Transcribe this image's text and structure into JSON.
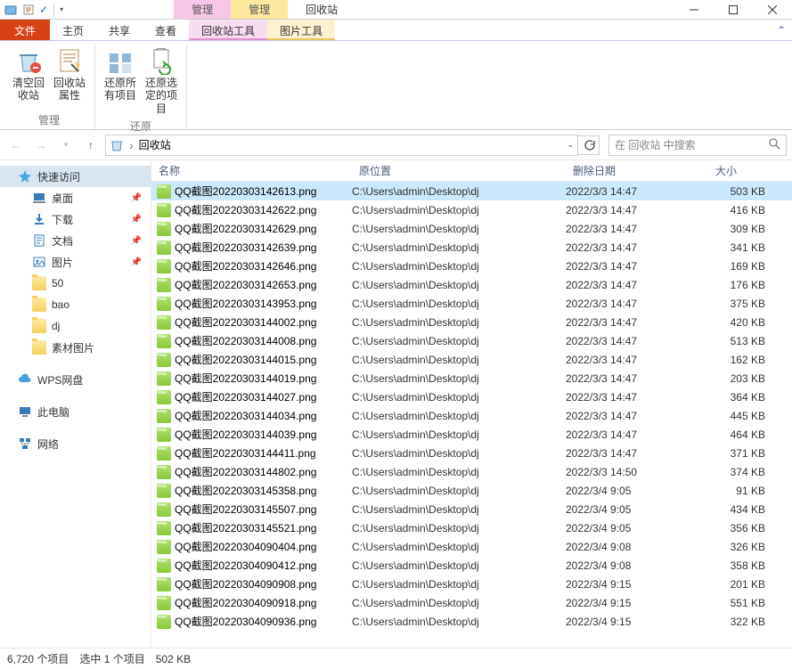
{
  "window": {
    "title": "回收站",
    "context_tab_pink": "管理",
    "context_tab_yellow": "管理"
  },
  "menu": {
    "file": "文件",
    "home": "主页",
    "share": "共享",
    "view": "查看",
    "recycle_tools": "回收站工具",
    "picture_tools": "图片工具"
  },
  "ribbon": {
    "group_manage": "管理",
    "group_restore": "还原",
    "empty_bin": "清空回收站",
    "bin_props": "回收站属性",
    "restore_all": "还原所有项目",
    "restore_selected": "还原选定的项目"
  },
  "toolbar": {
    "breadcrumb": "回收站",
    "search_placeholder": "在 回收站 中搜索"
  },
  "sidebar": {
    "quick_access": "快速访问",
    "items": [
      {
        "label": "桌面",
        "icon": "desktop",
        "pinned": true
      },
      {
        "label": "下载",
        "icon": "downloads",
        "pinned": true
      },
      {
        "label": "文档",
        "icon": "documents",
        "pinned": true
      },
      {
        "label": "图片",
        "icon": "pictures",
        "pinned": true
      },
      {
        "label": "50",
        "icon": "folder",
        "pinned": false
      },
      {
        "label": "bao",
        "icon": "folder",
        "pinned": false
      },
      {
        "label": "dj",
        "icon": "folder",
        "pinned": false
      },
      {
        "label": "素材图片",
        "icon": "folder",
        "pinned": false
      }
    ],
    "wps": "WPS网盘",
    "this_pc": "此电脑",
    "network": "网络"
  },
  "columns": {
    "name": "名称",
    "location": "原位置",
    "deleted": "删除日期",
    "size": "大小"
  },
  "files": [
    {
      "name": "QQ截图20220303142613.png",
      "loc": "C:\\Users\\admin\\Desktop\\dj",
      "date": "2022/3/3 14:47",
      "size": "503 KB",
      "selected": true
    },
    {
      "name": "QQ截图20220303142622.png",
      "loc": "C:\\Users\\admin\\Desktop\\dj",
      "date": "2022/3/3 14:47",
      "size": "416 KB"
    },
    {
      "name": "QQ截图20220303142629.png",
      "loc": "C:\\Users\\admin\\Desktop\\dj",
      "date": "2022/3/3 14:47",
      "size": "309 KB"
    },
    {
      "name": "QQ截图20220303142639.png",
      "loc": "C:\\Users\\admin\\Desktop\\dj",
      "date": "2022/3/3 14:47",
      "size": "341 KB"
    },
    {
      "name": "QQ截图20220303142646.png",
      "loc": "C:\\Users\\admin\\Desktop\\dj",
      "date": "2022/3/3 14:47",
      "size": "169 KB"
    },
    {
      "name": "QQ截图20220303142653.png",
      "loc": "C:\\Users\\admin\\Desktop\\dj",
      "date": "2022/3/3 14:47",
      "size": "176 KB"
    },
    {
      "name": "QQ截图20220303143953.png",
      "loc": "C:\\Users\\admin\\Desktop\\dj",
      "date": "2022/3/3 14:47",
      "size": "375 KB"
    },
    {
      "name": "QQ截图20220303144002.png",
      "loc": "C:\\Users\\admin\\Desktop\\dj",
      "date": "2022/3/3 14:47",
      "size": "420 KB"
    },
    {
      "name": "QQ截图20220303144008.png",
      "loc": "C:\\Users\\admin\\Desktop\\dj",
      "date": "2022/3/3 14:47",
      "size": "513 KB"
    },
    {
      "name": "QQ截图20220303144015.png",
      "loc": "C:\\Users\\admin\\Desktop\\dj",
      "date": "2022/3/3 14:47",
      "size": "162 KB"
    },
    {
      "name": "QQ截图20220303144019.png",
      "loc": "C:\\Users\\admin\\Desktop\\dj",
      "date": "2022/3/3 14:47",
      "size": "203 KB"
    },
    {
      "name": "QQ截图20220303144027.png",
      "loc": "C:\\Users\\admin\\Desktop\\dj",
      "date": "2022/3/3 14:47",
      "size": "364 KB"
    },
    {
      "name": "QQ截图20220303144034.png",
      "loc": "C:\\Users\\admin\\Desktop\\dj",
      "date": "2022/3/3 14:47",
      "size": "445 KB"
    },
    {
      "name": "QQ截图20220303144039.png",
      "loc": "C:\\Users\\admin\\Desktop\\dj",
      "date": "2022/3/3 14:47",
      "size": "464 KB"
    },
    {
      "name": "QQ截图20220303144411.png",
      "loc": "C:\\Users\\admin\\Desktop\\dj",
      "date": "2022/3/3 14:47",
      "size": "371 KB"
    },
    {
      "name": "QQ截图20220303144802.png",
      "loc": "C:\\Users\\admin\\Desktop\\dj",
      "date": "2022/3/3 14:50",
      "size": "374 KB"
    },
    {
      "name": "QQ截图20220303145358.png",
      "loc": "C:\\Users\\admin\\Desktop\\dj",
      "date": "2022/3/4 9:05",
      "size": "91 KB"
    },
    {
      "name": "QQ截图20220303145507.png",
      "loc": "C:\\Users\\admin\\Desktop\\dj",
      "date": "2022/3/4 9:05",
      "size": "434 KB"
    },
    {
      "name": "QQ截图20220303145521.png",
      "loc": "C:\\Users\\admin\\Desktop\\dj",
      "date": "2022/3/4 9:05",
      "size": "356 KB"
    },
    {
      "name": "QQ截图20220304090404.png",
      "loc": "C:\\Users\\admin\\Desktop\\dj",
      "date": "2022/3/4 9:08",
      "size": "326 KB"
    },
    {
      "name": "QQ截图20220304090412.png",
      "loc": "C:\\Users\\admin\\Desktop\\dj",
      "date": "2022/3/4 9:08",
      "size": "358 KB"
    },
    {
      "name": "QQ截图20220304090908.png",
      "loc": "C:\\Users\\admin\\Desktop\\dj",
      "date": "2022/3/4 9:15",
      "size": "201 KB"
    },
    {
      "name": "QQ截图20220304090918.png",
      "loc": "C:\\Users\\admin\\Desktop\\dj",
      "date": "2022/3/4 9:15",
      "size": "551 KB"
    },
    {
      "name": "QQ截图20220304090936.png",
      "loc": "C:\\Users\\admin\\Desktop\\dj",
      "date": "2022/3/4 9:15",
      "size": "322 KB"
    }
  ],
  "status": {
    "count": "6,720 个项目",
    "selected": "选中 1 个项目",
    "size": "502 KB"
  }
}
